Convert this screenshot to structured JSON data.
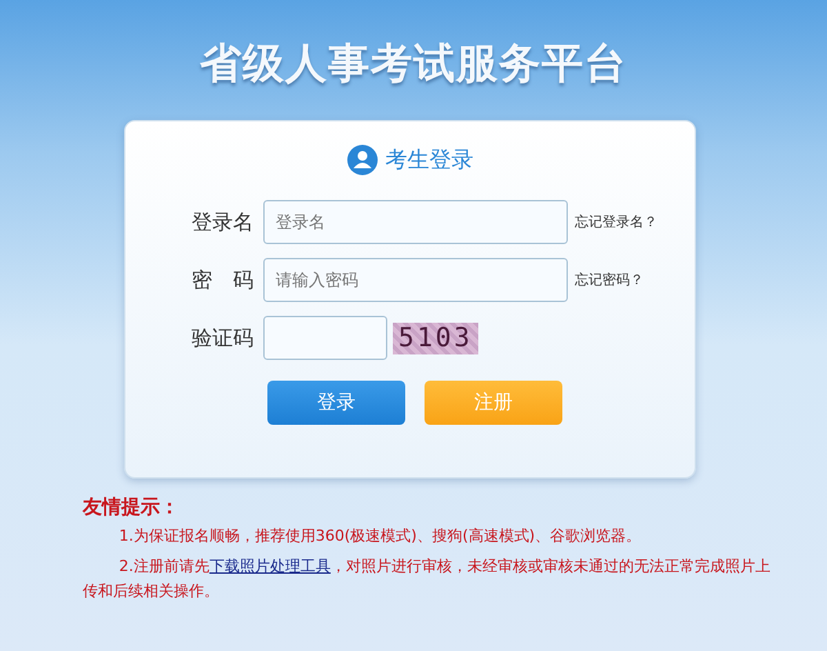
{
  "header": {
    "title": "省级人事考试服务平台"
  },
  "login": {
    "title": "考生登录",
    "fields": [
      {
        "label": "登录名",
        "placeholder": "登录名",
        "help": "忘记登录名？",
        "kind": "text"
      },
      {
        "label": "密　码",
        "placeholder": "请输入密码",
        "help": "忘记密码？",
        "kind": "password"
      },
      {
        "label": "验证码",
        "captcha": "5103",
        "kind": "captcha"
      }
    ],
    "buttons": [
      {
        "label": "登录",
        "kind": "primary"
      },
      {
        "label": "注册",
        "kind": "secondary"
      }
    ]
  },
  "notes": {
    "title": "友情提示：",
    "items": [
      {
        "text": "1.为保证报名顺畅，推荐使用360(极速模式)、搜狗(高速模式)、谷歌浏览器。"
      },
      {
        "before": "2.注册前请先",
        "link": "下载照片处理工具",
        "after": "，对照片进行审核，未经审核或审核未通过的无法正常完成照片上传和后续相关操作。"
      }
    ]
  }
}
